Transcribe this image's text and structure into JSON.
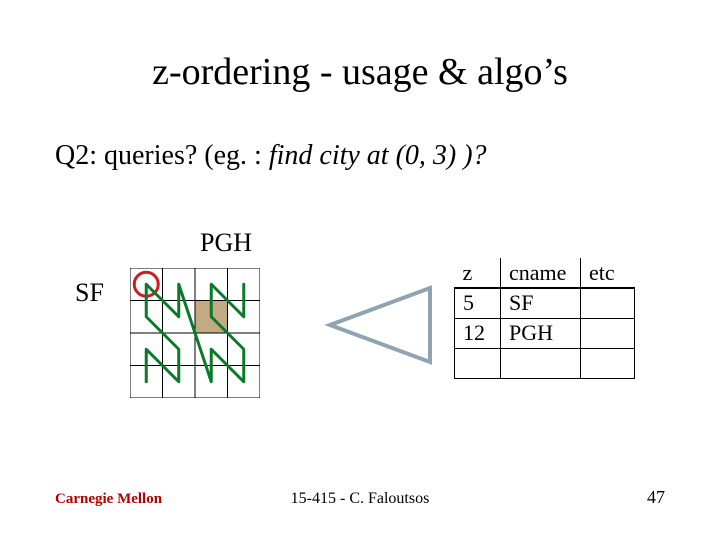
{
  "title": "z-ordering - usage & algo’s",
  "subtitle_plain": "Q2: queries? (eg. : ",
  "subtitle_italic": "find city at (0, 3) )?",
  "labels": {
    "pgh": "PGH",
    "sf": "SF"
  },
  "table": {
    "headers": [
      "z",
      "cname",
      "etc"
    ],
    "rows": [
      {
        "z": "5",
        "cname": "SF",
        "etc": ""
      },
      {
        "z": "12",
        "cname": "PGH",
        "etc": ""
      },
      {
        "z": "",
        "cname": "",
        "etc": ""
      }
    ]
  },
  "footer": {
    "left": "Carnegie Mellon",
    "center": "15-415 - C. Faloutsos",
    "right": "47"
  },
  "colors": {
    "zline": "#0a7a2a",
    "sf_marker": "#d01c1c",
    "pgh_fill": "#c4a985",
    "tri": "#8fa3b3"
  }
}
